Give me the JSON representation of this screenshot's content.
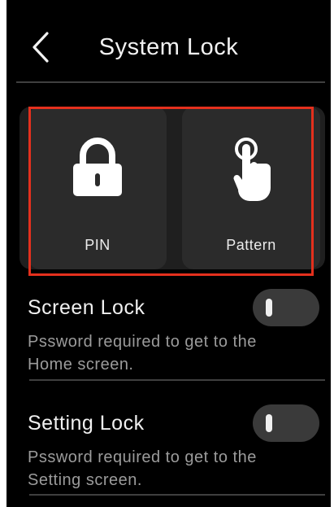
{
  "header": {
    "title": "System Lock",
    "back_icon": "chevron-left-icon"
  },
  "lock_options": [
    {
      "label": "PIN",
      "icon": "padlock-icon"
    },
    {
      "label": "Pattern",
      "icon": "tap-finger-icon"
    }
  ],
  "settings": [
    {
      "title": "Screen Lock",
      "description": "Pssword required to get to the Home screen.",
      "enabled": false
    },
    {
      "title": "Setting Lock",
      "description": "Pssword required to get to the Setting screen.",
      "enabled": false
    }
  ],
  "colors": {
    "background": "#000000",
    "highlight": "#e4301d",
    "panel": "#2b2b2b",
    "toggle": "#3a3a3a"
  }
}
